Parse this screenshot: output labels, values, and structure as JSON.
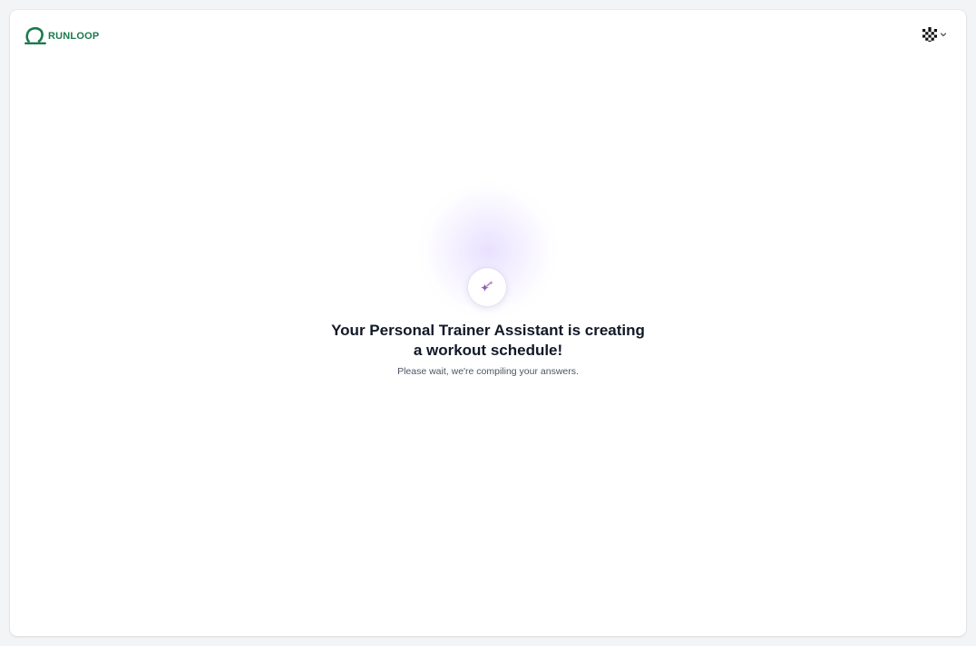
{
  "header": {
    "brand": "RUNLOOP",
    "logo_icon": "runloop-logo-icon",
    "avatar_icon": "checkered-avatar-icon",
    "menu_icon": "chevron-down-icon"
  },
  "main": {
    "badge_icon": "sparkles-icon",
    "title_line1": "Your Personal Trainer Assistant is creating",
    "title_line2": "a workout schedule!",
    "subtitle": "Please wait, we're compiling your answers."
  },
  "colors": {
    "brand_green": "#1a7a4c",
    "sparkle_purple": "#8e5ab8",
    "sparkle_pink": "#c57bb4",
    "title_text": "#111827",
    "subtitle_text": "#4b5563",
    "page_bg": "#f3f4f6",
    "card_bg": "#ffffff"
  }
}
